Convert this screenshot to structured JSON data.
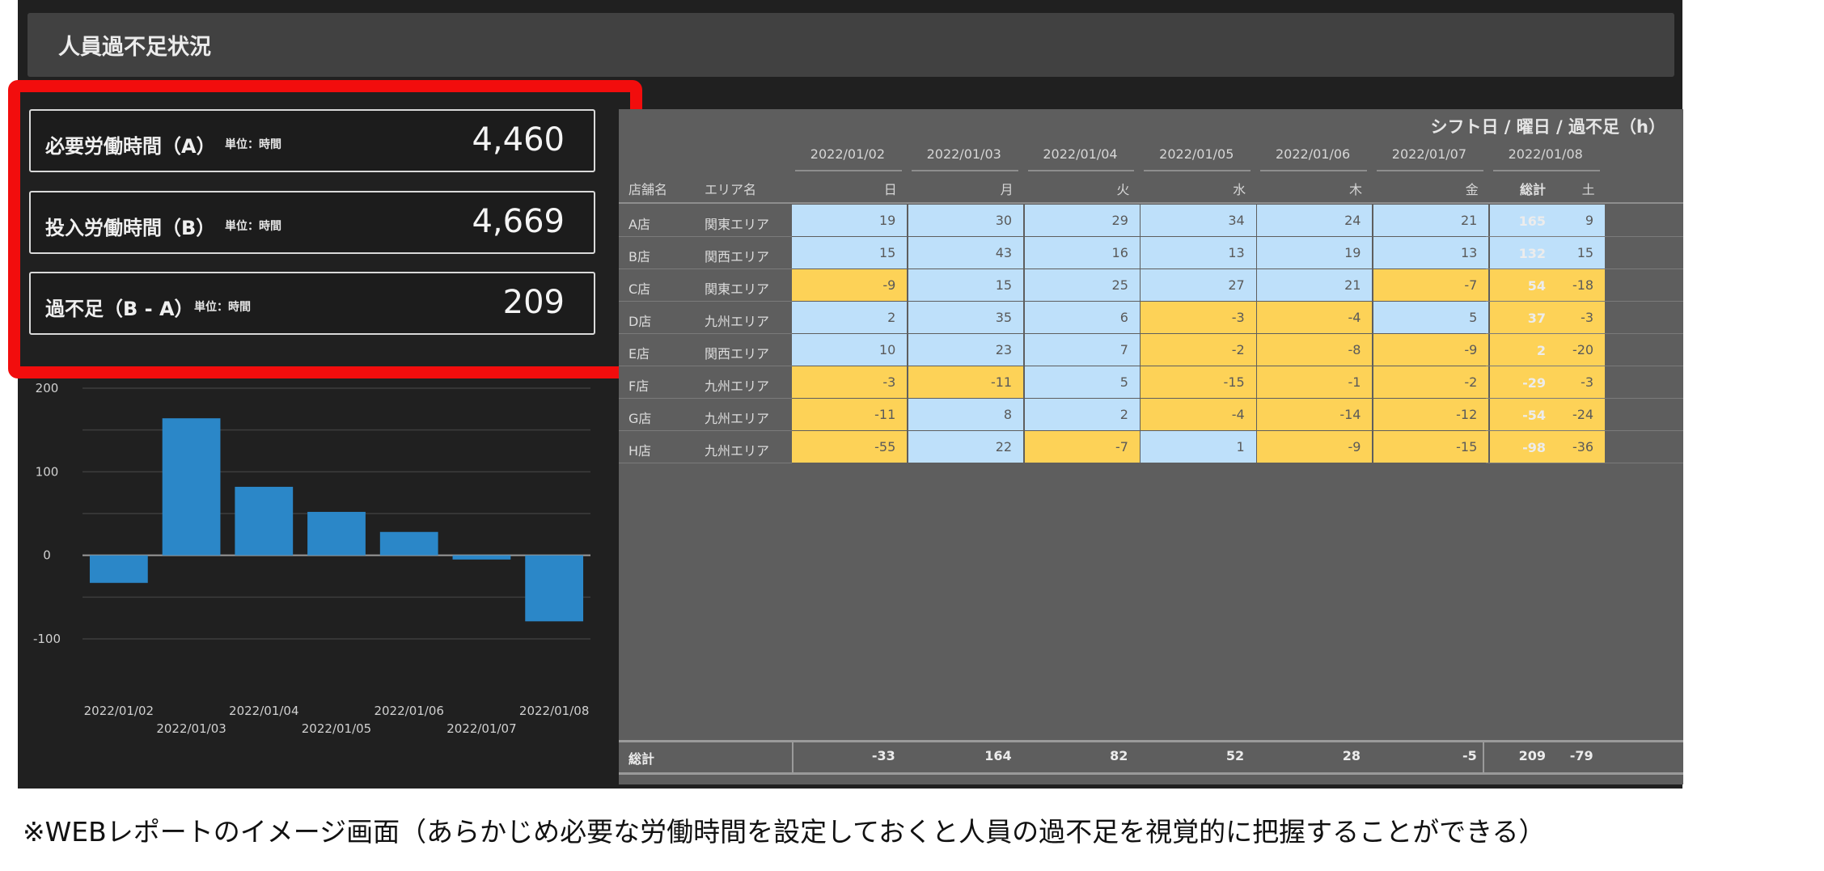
{
  "header": {
    "title": "人員過不足状況"
  },
  "kpis": [
    {
      "label": "必要労働時間（A）",
      "unit": "単位：時間",
      "value": "4,460"
    },
    {
      "label": "投入労働時間（B）",
      "unit": "単位：時間",
      "value": "4,669"
    },
    {
      "label": "過不足（B - A）",
      "unit": "単位：時間",
      "value": "209"
    }
  ],
  "table": {
    "caption": "シフト日 / 曜日 / 過不足（h）",
    "store_header": "店舗名",
    "area_header": "エリア名",
    "total_header": "総計",
    "dates": [
      "2022/01/02",
      "2022/01/03",
      "2022/01/04",
      "2022/01/05",
      "2022/01/06",
      "2022/01/07",
      "2022/01/08"
    ],
    "weekdays": [
      "日",
      "月",
      "火",
      "水",
      "木",
      "金",
      "土"
    ],
    "rows": [
      {
        "store": "A店",
        "area": "関東エリア",
        "values": [
          19,
          30,
          29,
          34,
          24,
          21,
          9
        ],
        "total": "165"
      },
      {
        "store": "B店",
        "area": "関西エリア",
        "values": [
          15,
          43,
          16,
          13,
          19,
          13,
          15
        ],
        "total": "132"
      },
      {
        "store": "C店",
        "area": "関東エリア",
        "values": [
          -9,
          15,
          25,
          27,
          21,
          -7,
          -18
        ],
        "total": "54"
      },
      {
        "store": "D店",
        "area": "九州エリア",
        "values": [
          2,
          35,
          6,
          -3,
          -4,
          5,
          -3
        ],
        "total": "37"
      },
      {
        "store": "E店",
        "area": "関西エリア",
        "values": [
          10,
          23,
          7,
          -2,
          -8,
          -9,
          -20
        ],
        "total": "2"
      },
      {
        "store": "F店",
        "area": "九州エリア",
        "values": [
          -3,
          -11,
          5,
          -15,
          -1,
          -2,
          -3
        ],
        "total": "-29"
      },
      {
        "store": "G店",
        "area": "九州エリア",
        "values": [
          -11,
          8,
          2,
          -4,
          -14,
          -12,
          -24
        ],
        "total": "-54"
      },
      {
        "store": "H店",
        "area": "九州エリア",
        "values": [
          -55,
          22,
          -7,
          1,
          -9,
          -15,
          -36
        ],
        "total": "-98"
      }
    ],
    "footer": {
      "label": "総計",
      "values": [
        "-33",
        "164",
        "82",
        "52",
        "28",
        "-5",
        "-79"
      ],
      "grand_total": "209"
    },
    "colors": {
      "positive": "#bee0fa",
      "negative": "#fdd257",
      "grid": "#8e8e8e"
    }
  },
  "chart_data": {
    "type": "bar",
    "categories": [
      "2022/01/02",
      "2022/01/03",
      "2022/01/04",
      "2022/01/05",
      "2022/01/06",
      "2022/01/07",
      "2022/01/08"
    ],
    "values": [
      -33,
      164,
      82,
      52,
      28,
      -5,
      -79
    ],
    "ylim": [
      -100,
      200
    ],
    "yticks": [
      "200",
      "100",
      "0",
      "-100"
    ],
    "grid": true,
    "bar_color": "#2b87c8"
  },
  "caption": "※WEBレポートのイメージ画面（あらかじめ必要な労働時間を設定しておくと人員の過不足を視覚的に把握することができる）"
}
